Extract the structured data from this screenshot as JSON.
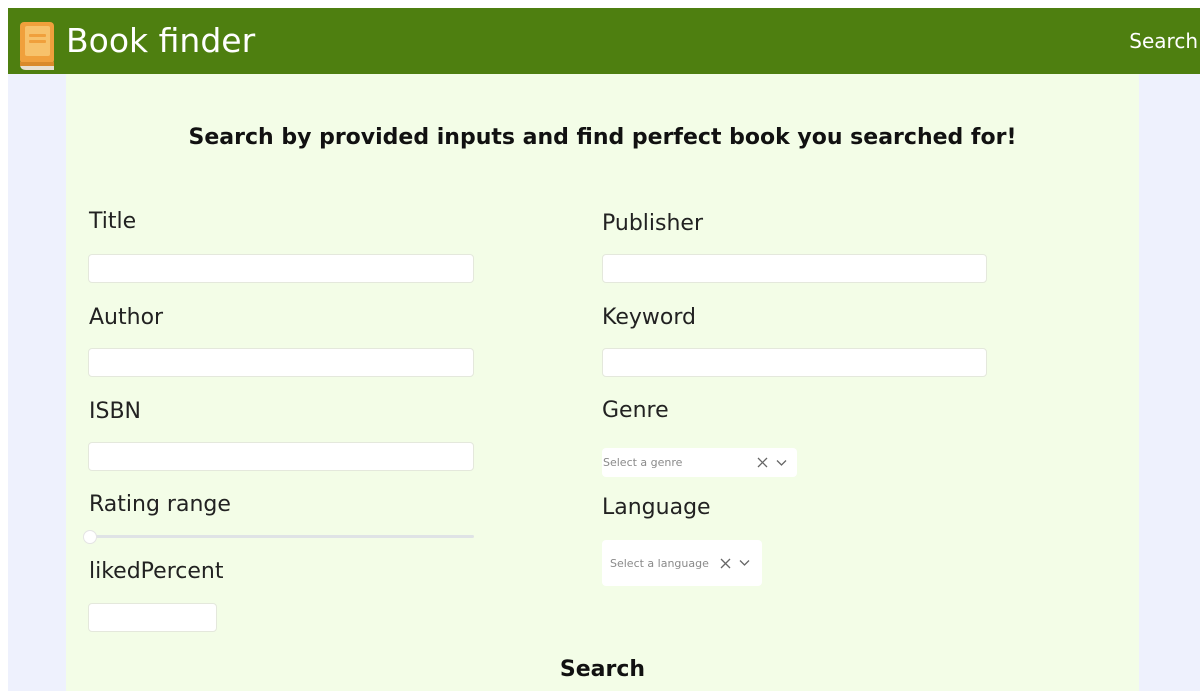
{
  "header": {
    "app_title": "Book finder",
    "nav_search_label": "Search",
    "logo_icon": "book-icon"
  },
  "main": {
    "headline": "Search by provided inputs and find perfect book you searched for!",
    "fields": {
      "title": {
        "label": "Title",
        "value": ""
      },
      "author": {
        "label": "Author",
        "value": ""
      },
      "isbn": {
        "label": "ISBN",
        "value": ""
      },
      "rating": {
        "label": "Rating range"
      },
      "liked": {
        "label": "likedPercent",
        "value": ""
      },
      "publisher": {
        "label": "Publisher",
        "value": ""
      },
      "keyword": {
        "label": "Keyword",
        "value": ""
      },
      "genre": {
        "label": "Genre",
        "placeholder": "Select a genre"
      },
      "language": {
        "label": "Language",
        "placeholder": "Select a language"
      }
    },
    "submit_label": "Search"
  },
  "colors": {
    "header_bg": "#4e7f10",
    "panel_bg": "#f3fde7",
    "page_bg": "#eef1fd"
  }
}
